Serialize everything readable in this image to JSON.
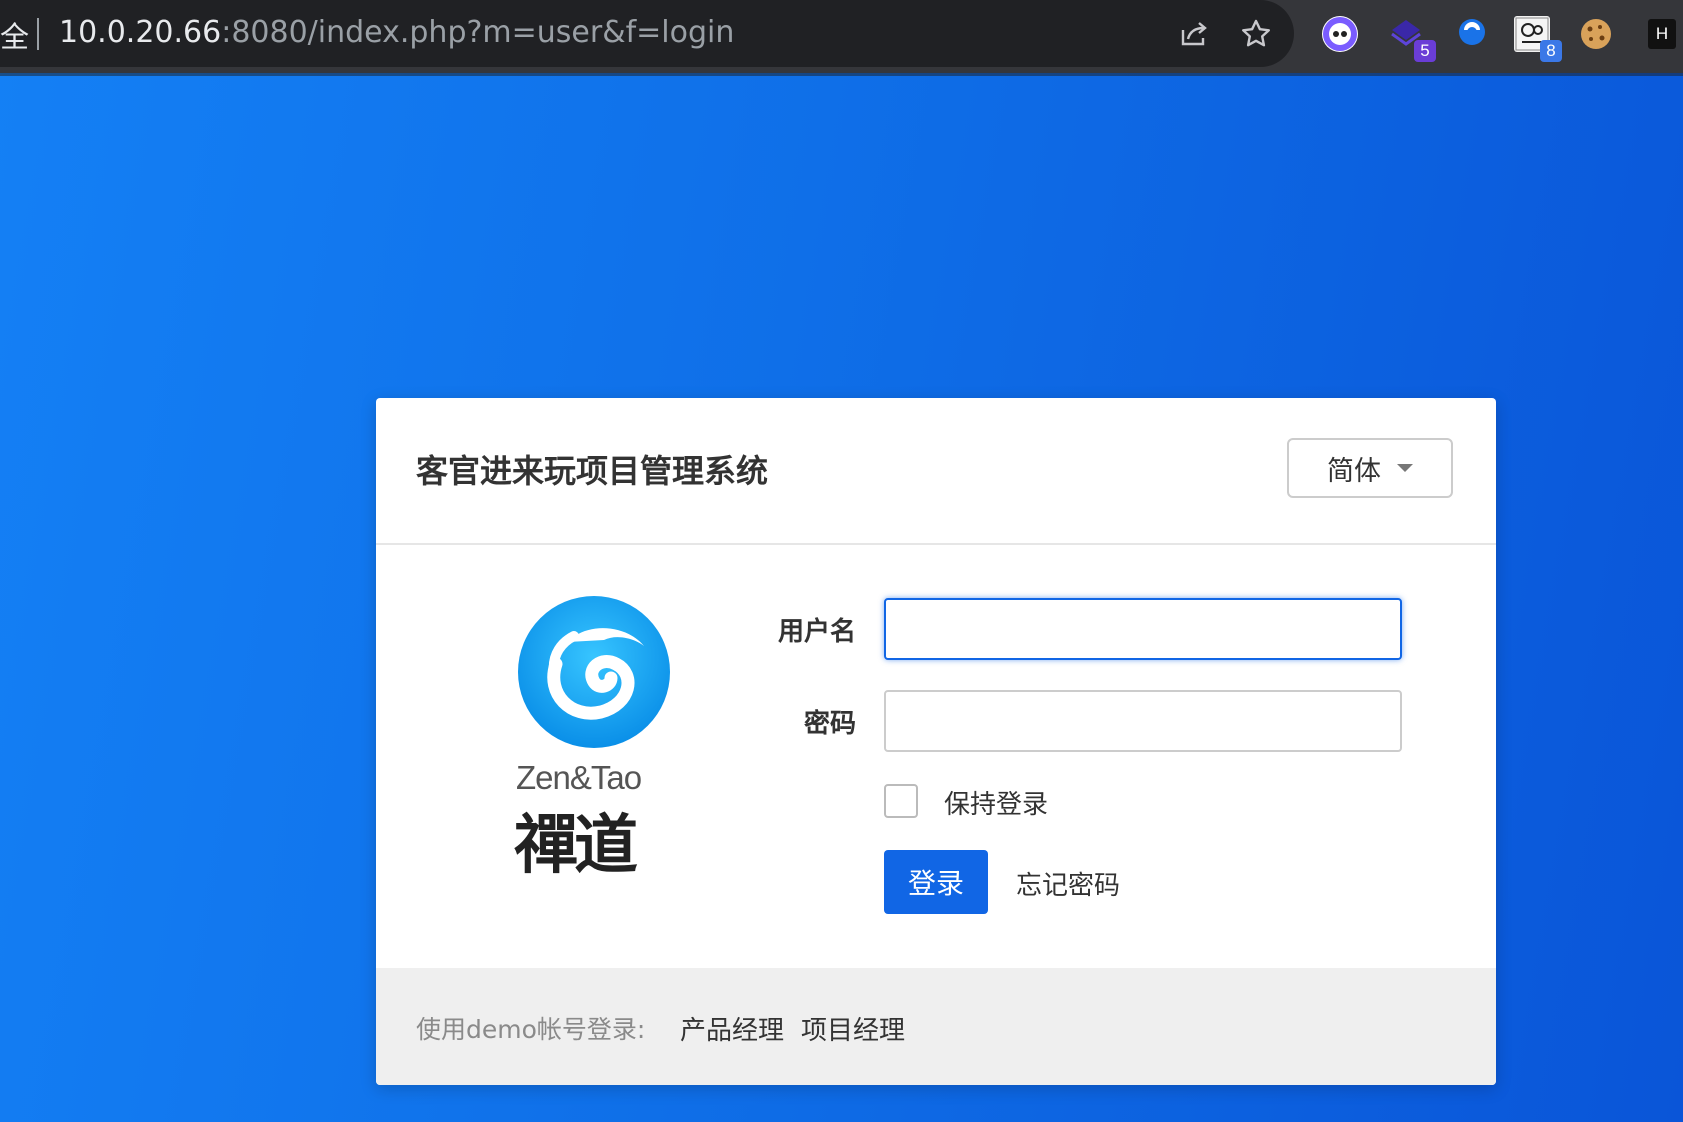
{
  "browser": {
    "security_text": "全",
    "url_host": "10.0.20.66",
    "url_rest": ":8080/index.php?m=user&f=login",
    "extensions": [
      {
        "name": "ext-1",
        "color": "#6b4eff"
      },
      {
        "name": "ext-2",
        "color": "#4b2bb8",
        "badge": "5",
        "badge_color": "#6a3dd6"
      },
      {
        "name": "ext-3",
        "color": "#1a73e8"
      },
      {
        "name": "ext-4",
        "color": "#f1f1f1",
        "badge": "8",
        "badge_color": "#3b78e7"
      },
      {
        "name": "ext-5",
        "color": "#d9a25a"
      },
      {
        "name": "ext-6",
        "label": "H"
      }
    ]
  },
  "login": {
    "title": "客官进来玩项目管理系统",
    "language": "简体",
    "logo_en": "Zen&Tao",
    "logo_cn": "禪道",
    "username_label": "用户名",
    "username_value": "",
    "password_label": "密码",
    "password_value": "",
    "remember_label": "保持登录",
    "login_button": "登录",
    "forgot_link": "忘记密码"
  },
  "footer": {
    "demo_label": "使用demo帐号登录:",
    "demo_accounts": [
      "产品经理",
      "项目经理"
    ]
  },
  "colors": {
    "accent": "#1166e5",
    "background_start": "#1480f5",
    "background_end": "#0a55d8"
  }
}
